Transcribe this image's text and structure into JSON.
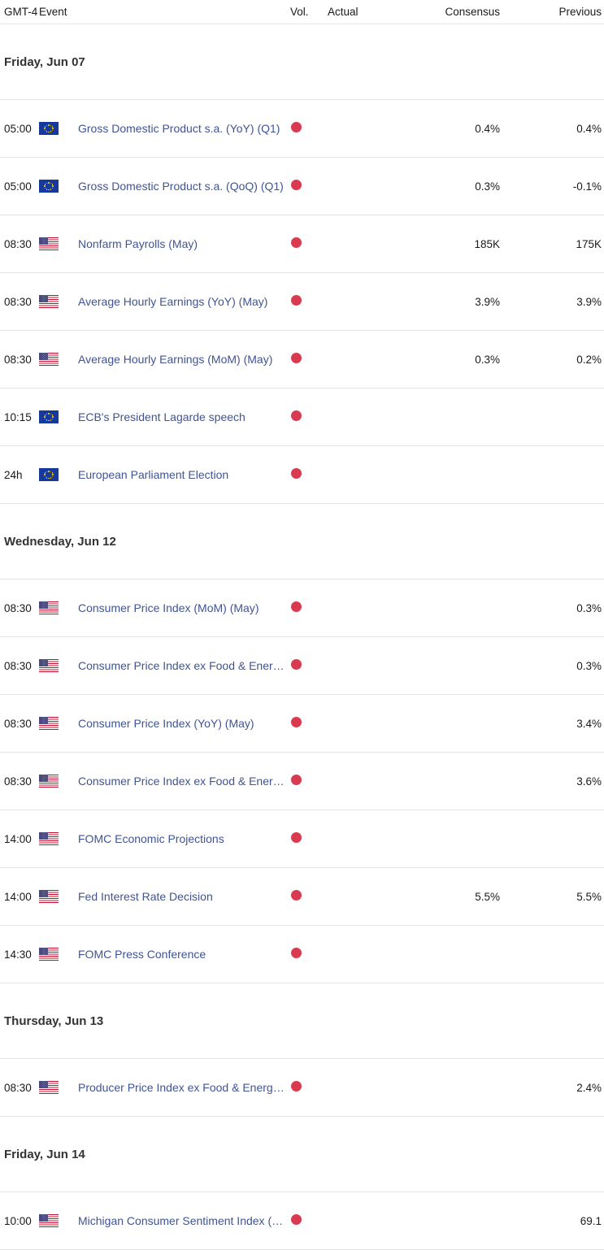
{
  "header": {
    "timezone": "GMT-4",
    "event": "Event",
    "vol": "Vol.",
    "actual": "Actual",
    "consensus": "Consensus",
    "previous": "Previous"
  },
  "colors": {
    "volatility_high": "#d93a4f",
    "event_link": "#3f5494",
    "row_divider": "#e3e3e3",
    "date_header_text": "#333333"
  },
  "groups": [
    {
      "date": "Friday, Jun 07",
      "rows": [
        {
          "time": "05:00",
          "flag": "eu-flag-icon",
          "event": "Gross Domestic Product s.a. (YoY) (Q1)",
          "volatility": "high",
          "actual": "",
          "consensus": "0.4%",
          "previous": "0.4%"
        },
        {
          "time": "05:00",
          "flag": "eu-flag-icon",
          "event": "Gross Domestic Product s.a. (QoQ) (Q1)",
          "volatility": "high",
          "actual": "",
          "consensus": "0.3%",
          "previous": "-0.1%"
        },
        {
          "time": "08:30",
          "flag": "us-flag-icon",
          "event": "Nonfarm Payrolls (May)",
          "volatility": "high",
          "actual": "",
          "consensus": "185K",
          "previous": "175K"
        },
        {
          "time": "08:30",
          "flag": "us-flag-icon",
          "event": "Average Hourly Earnings (YoY) (May)",
          "volatility": "high",
          "actual": "",
          "consensus": "3.9%",
          "previous": "3.9%"
        },
        {
          "time": "08:30",
          "flag": "us-flag-icon",
          "event": "Average Hourly Earnings (MoM) (May)",
          "volatility": "high",
          "actual": "",
          "consensus": "0.3%",
          "previous": "0.2%"
        },
        {
          "time": "10:15",
          "flag": "eu-flag-icon",
          "event": "ECB's President Lagarde speech",
          "volatility": "high",
          "actual": "",
          "consensus": "",
          "previous": ""
        },
        {
          "time": "24h",
          "flag": "eu-flag-icon",
          "event": "European Parliament Election",
          "volatility": "high",
          "actual": "",
          "consensus": "",
          "previous": ""
        }
      ]
    },
    {
      "date": "Wednesday, Jun 12",
      "rows": [
        {
          "time": "08:30",
          "flag": "us-flag-icon",
          "event": "Consumer Price Index (MoM) (May)",
          "volatility": "high",
          "actual": "",
          "consensus": "",
          "previous": "0.3%"
        },
        {
          "time": "08:30",
          "flag": "us-flag-icon",
          "event": "Consumer Price Index ex Food & Energy (MoM) (May)",
          "volatility": "high",
          "actual": "",
          "consensus": "",
          "previous": "0.3%"
        },
        {
          "time": "08:30",
          "flag": "us-flag-icon",
          "event": "Consumer Price Index (YoY) (May)",
          "volatility": "high",
          "actual": "",
          "consensus": "",
          "previous": "3.4%"
        },
        {
          "time": "08:30",
          "flag": "us-flag-icon",
          "event": "Consumer Price Index ex Food & Energy (YoY) (May)",
          "volatility": "high",
          "actual": "",
          "consensus": "",
          "previous": "3.6%"
        },
        {
          "time": "14:00",
          "flag": "us-flag-icon",
          "event": "FOMC Economic Projections",
          "volatility": "high",
          "actual": "",
          "consensus": "",
          "previous": ""
        },
        {
          "time": "14:00",
          "flag": "us-flag-icon",
          "event": "Fed Interest Rate Decision",
          "volatility": "high",
          "actual": "",
          "consensus": "5.5%",
          "previous": "5.5%"
        },
        {
          "time": "14:30",
          "flag": "us-flag-icon",
          "event": "FOMC Press Conference",
          "volatility": "high",
          "actual": "",
          "consensus": "",
          "previous": ""
        }
      ]
    },
    {
      "date": "Thursday, Jun 13",
      "rows": [
        {
          "time": "08:30",
          "flag": "us-flag-icon",
          "event": "Producer Price Index ex Food & Energy (YoY) (May)",
          "volatility": "high",
          "actual": "",
          "consensus": "",
          "previous": "2.4%"
        }
      ]
    },
    {
      "date": "Friday, Jun 14",
      "rows": [
        {
          "time": "10:00",
          "flag": "us-flag-icon",
          "event": "Michigan Consumer Sentiment Index (Jun) PREL",
          "volatility": "high",
          "actual": "",
          "consensus": "",
          "previous": "69.1"
        }
      ]
    }
  ]
}
